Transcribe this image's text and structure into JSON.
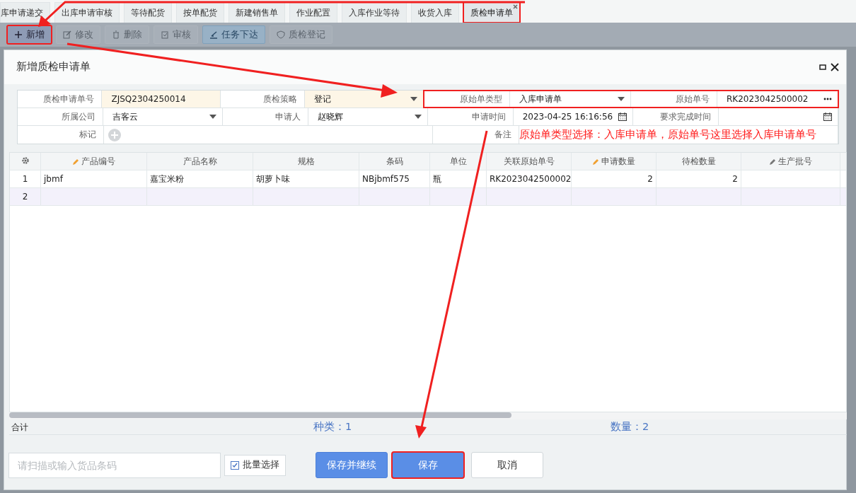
{
  "tabs": [
    {
      "label": "库申请递交",
      "selected": false,
      "annotated": false
    },
    {
      "label": "出库申请审核",
      "selected": false,
      "annotated": false
    },
    {
      "label": "等待配货",
      "selected": false,
      "annotated": false
    },
    {
      "label": "按单配货",
      "selected": false,
      "annotated": false
    },
    {
      "label": "新建销售单",
      "selected": false,
      "annotated": false
    },
    {
      "label": "作业配置",
      "selected": false,
      "annotated": false
    },
    {
      "label": "入库作业等待",
      "selected": false,
      "annotated": false
    },
    {
      "label": "收货入库",
      "selected": false,
      "annotated": false
    },
    {
      "label": "质检申请单",
      "selected": true,
      "annotated": true
    }
  ],
  "toolbar": [
    {
      "label": "新增",
      "disabled": false,
      "annotated": true
    },
    {
      "label": "修改",
      "disabled": true,
      "annotated": false
    },
    {
      "label": "删除",
      "disabled": true,
      "annotated": false
    },
    {
      "label": "审核",
      "disabled": true,
      "annotated": false
    },
    {
      "label": "任务下达",
      "disabled": false,
      "annotated": false
    },
    {
      "label": "质检登记",
      "disabled": true,
      "annotated": false
    }
  ],
  "dialog": {
    "title": "新增质检申请单",
    "form": [
      [
        {
          "label": "质检申请单号",
          "value": "ZJSQ2304250014",
          "kind": "text",
          "required": true
        },
        {
          "label": "质检策略",
          "value": "登记",
          "kind": "select",
          "required": true
        },
        {
          "label": "原始单类型",
          "value": "入库申请单",
          "kind": "select",
          "required": false,
          "annotated": true
        },
        {
          "label": "原始单号",
          "value": "RK2023042500002",
          "kind": "lookup",
          "required": false,
          "annotated": true
        }
      ],
      [
        {
          "label": "所属公司",
          "value": "吉客云",
          "kind": "select",
          "required": false
        },
        {
          "label": "申请人",
          "value": "赵晓辉",
          "kind": "select",
          "required": false
        },
        {
          "label": "申请时间",
          "value": "2023-04-25 16:16:56",
          "kind": "date",
          "required": false
        },
        {
          "label": "要求完成时间",
          "kind": "date",
          "required": false
        }
      ],
      [
        {
          "label": "标记",
          "kind": "add",
          "required": false
        },
        {
          "label": "备注",
          "value": "原始单类型选择：入库申请单，原始单号这里选择入库申请单号",
          "kind": "remark",
          "required": false,
          "annotated": true
        }
      ]
    ],
    "grid": {
      "columns": [
        {
          "label": "产品编号",
          "editable": true,
          "color": "#f0a030"
        },
        {
          "label": "产品名称",
          "editable": false
        },
        {
          "label": "规格",
          "editable": false
        },
        {
          "label": "条码",
          "editable": false
        },
        {
          "label": "单位",
          "editable": false
        },
        {
          "label": "关联原始单号",
          "editable": false
        },
        {
          "label": "申请数量",
          "editable": true,
          "color": "#f0a030",
          "kind": "number"
        },
        {
          "label": "待检数量",
          "editable": false,
          "kind": "number"
        },
        {
          "label": "生产批号",
          "editable": true,
          "color": "#777777"
        }
      ],
      "rows": [
        {
          "index": "1",
          "selected": false,
          "cells": [
            "jbmf",
            "嘉宝米粉",
            "胡萝卜味",
            "NBjbmf575",
            "瓶",
            "RK2023042500002",
            "2",
            "2",
            ""
          ]
        },
        {
          "index": "2",
          "selected": true,
          "cells": [
            "",
            "",
            "",
            "",
            "",
            "",
            "",
            "",
            ""
          ]
        }
      ],
      "summary": {
        "label": "合计",
        "kinds": "种类：1",
        "quantity": "数量：2"
      }
    },
    "barcode_placeholder": "请扫描或输入货品条码",
    "batch_select": {
      "label": "批量选择",
      "checked": true
    },
    "buttons": [
      {
        "label": "保存并继续",
        "kind": "primary",
        "annotated": false
      },
      {
        "label": "保存",
        "kind": "primary",
        "annotated": true
      },
      {
        "label": "取消",
        "kind": "secondary",
        "annotated": false
      }
    ]
  }
}
